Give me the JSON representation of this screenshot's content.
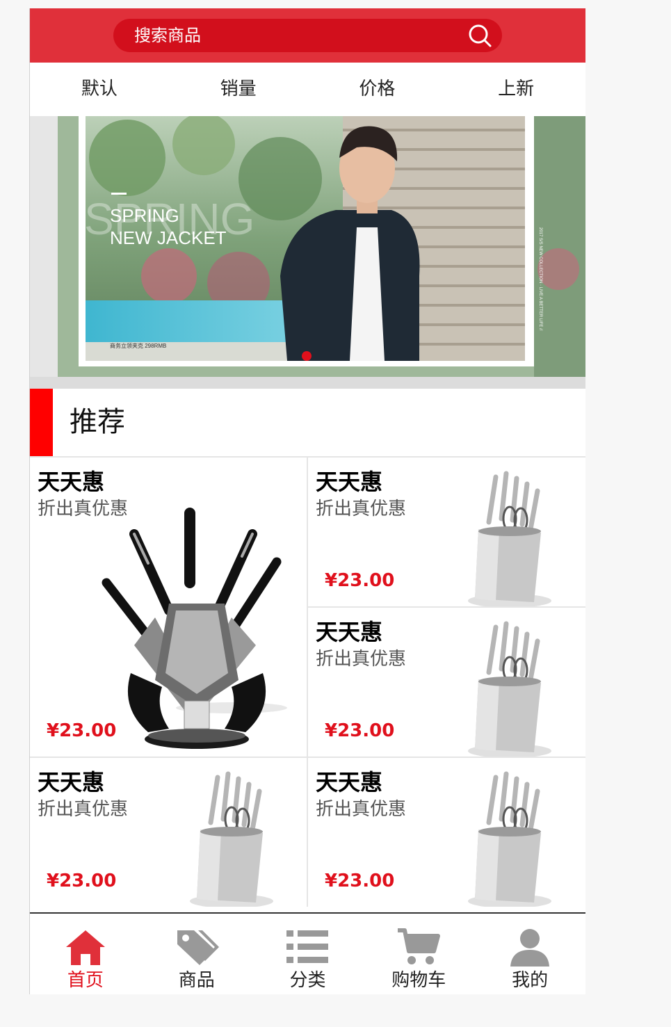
{
  "colors": {
    "header": "#e0303a",
    "search": "#d20f1c",
    "accent": "#e0101c",
    "section_bar": "#ff0000"
  },
  "search": {
    "placeholder": "搜索商品",
    "icon": "search-icon"
  },
  "sort_tabs": [
    "默认",
    "销量",
    "价格",
    "上新"
  ],
  "banner": {
    "headline_1": "SPRING",
    "headline_2": "NEW JACKET",
    "watermark": "SPRING",
    "side_text": "2017 S/S NEW COLLECTION · LIVE A BETTER LIFE //",
    "tag": "商务立领夹克 298RMB",
    "active_slide": 1
  },
  "section": {
    "title": "推荐"
  },
  "products": [
    {
      "title": "天天惠",
      "subtitle": "折出真优惠",
      "price": "¥23.00",
      "image": "knife-stand-black"
    },
    {
      "title": "天天惠",
      "subtitle": "折出真优惠",
      "price": "¥23.00",
      "image": "knife-block-silver"
    },
    {
      "title": "天天惠",
      "subtitle": "折出真优惠",
      "price": "¥23.00",
      "image": "knife-block-silver"
    },
    {
      "title": "天天惠",
      "subtitle": "折出真优惠",
      "price": "¥23.00",
      "image": "knife-block-silver"
    },
    {
      "title": "天天惠",
      "subtitle": "折出真优惠",
      "price": "¥23.00",
      "image": "knife-block-silver"
    }
  ],
  "tabbar": [
    {
      "label": "首页",
      "icon": "home-icon",
      "active": true
    },
    {
      "label": "商品",
      "icon": "tag-icon",
      "active": false
    },
    {
      "label": "分类",
      "icon": "list-icon",
      "active": false
    },
    {
      "label": "购物车",
      "icon": "cart-icon",
      "active": false
    },
    {
      "label": "我的",
      "icon": "user-icon",
      "active": false
    }
  ]
}
